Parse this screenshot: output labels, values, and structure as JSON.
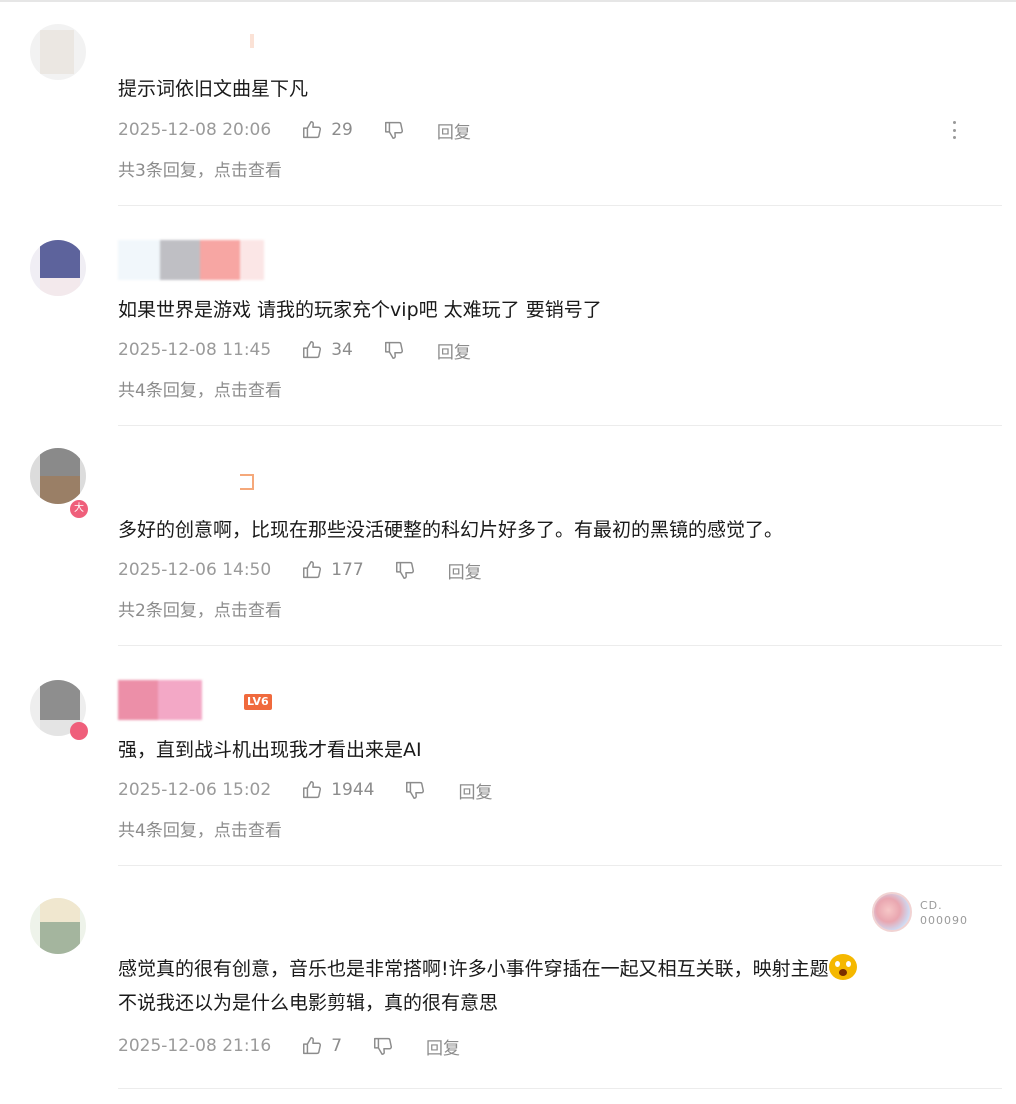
{
  "comments": [
    {
      "text": "提示词依旧文曲星下凡",
      "time": "2025-12-08 20:06",
      "likes": "29",
      "reply_label": "回复",
      "replies": "共3条回复，点击查看",
      "more_icon": "more-vertical-icon"
    },
    {
      "text": "如果世界是游戏 请我的玩家充个vip吧 太难玩了 要销号了",
      "time": "2025-12-08 11:45",
      "likes": "34",
      "reply_label": "回复",
      "replies": "共4条回复，点击查看"
    },
    {
      "text": "多好的创意啊，比现在那些没活硬整的科幻片好多了。有最初的黑镜的感觉了。",
      "time": "2025-12-06 14:50",
      "likes": "177",
      "reply_label": "回复",
      "replies": "共2条回复，点击查看",
      "badge": "大"
    },
    {
      "text": "强，直到战斗机出现我才看出来是AI",
      "time": "2025-12-06 15:02",
      "likes": "1944",
      "reply_label": "回复",
      "replies": "共4条回复，点击查看",
      "level": "LV6"
    },
    {
      "text_line1": "感觉真的很有创意，音乐也是非常搭啊!许多小事件穿插在一起又相互关联，映射主题",
      "text_line2": "不说我还以为是什么电影剪辑，真的很有意思",
      "time": "2025-12-08 21:16",
      "likes": "7",
      "reply_label": "回复",
      "pendant_line1": "CD.",
      "pendant_line2": "000090"
    }
  ],
  "colors": {
    "meta": "#8c8c8c",
    "text": "#1a1a1a",
    "divider": "#ececec",
    "level_badge": "#f06a3d"
  }
}
